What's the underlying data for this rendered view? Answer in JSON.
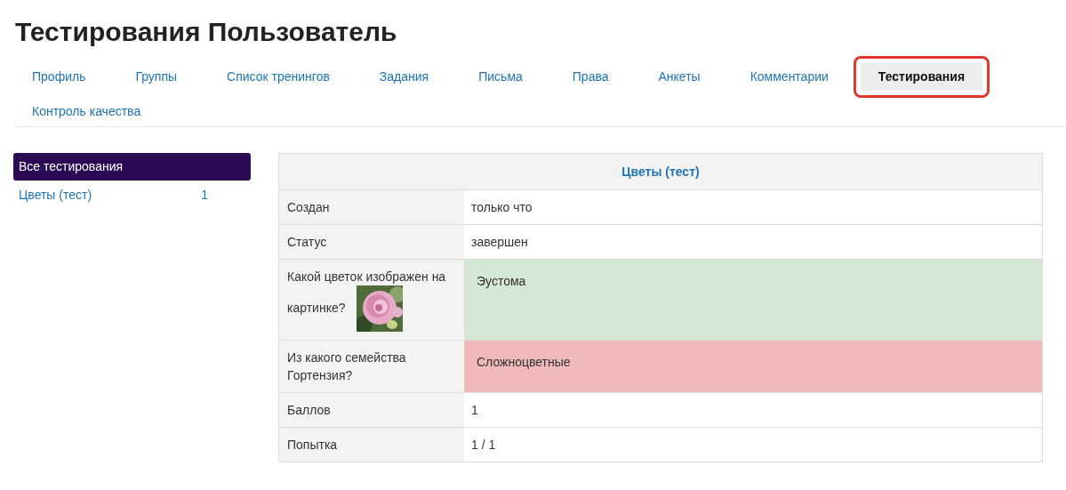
{
  "page_title": "Тестирования Пользователь",
  "tabs": [
    {
      "label": "Профиль",
      "selected": false,
      "highlighted": false
    },
    {
      "label": "Группы",
      "selected": false,
      "highlighted": false
    },
    {
      "label": "Список тренингов",
      "selected": false,
      "highlighted": false
    },
    {
      "label": "Задания",
      "selected": false,
      "highlighted": false
    },
    {
      "label": "Письма",
      "selected": false,
      "highlighted": false
    },
    {
      "label": "Права",
      "selected": false,
      "highlighted": false
    },
    {
      "label": "Анкеты",
      "selected": false,
      "highlighted": false
    },
    {
      "label": "Комментарии",
      "selected": false,
      "highlighted": false
    },
    {
      "label": "Тестирования",
      "selected": true,
      "highlighted": true
    },
    {
      "label": "Контроль качества",
      "selected": false,
      "highlighted": false
    }
  ],
  "sidebar": {
    "items": [
      {
        "label": "Все тестирования",
        "selected": true
      },
      {
        "label": "Цветы (тест)",
        "count": "1",
        "selected": false
      }
    ]
  },
  "table": {
    "title": "Цветы (тест)",
    "rows": [
      {
        "label": "Создан",
        "value": "только что"
      },
      {
        "label": "Статус",
        "value": "завершен"
      },
      {
        "label": "Какой цветок изображен на картинке?",
        "value": "Эустома",
        "correct": true
      },
      {
        "label": "Из какого семейства Гортензия?",
        "value": "Сложноцветные",
        "correct": false
      },
      {
        "label": "Баллов",
        "value": "1"
      },
      {
        "label": "Попытка",
        "value": "1 / 1"
      }
    ]
  }
}
